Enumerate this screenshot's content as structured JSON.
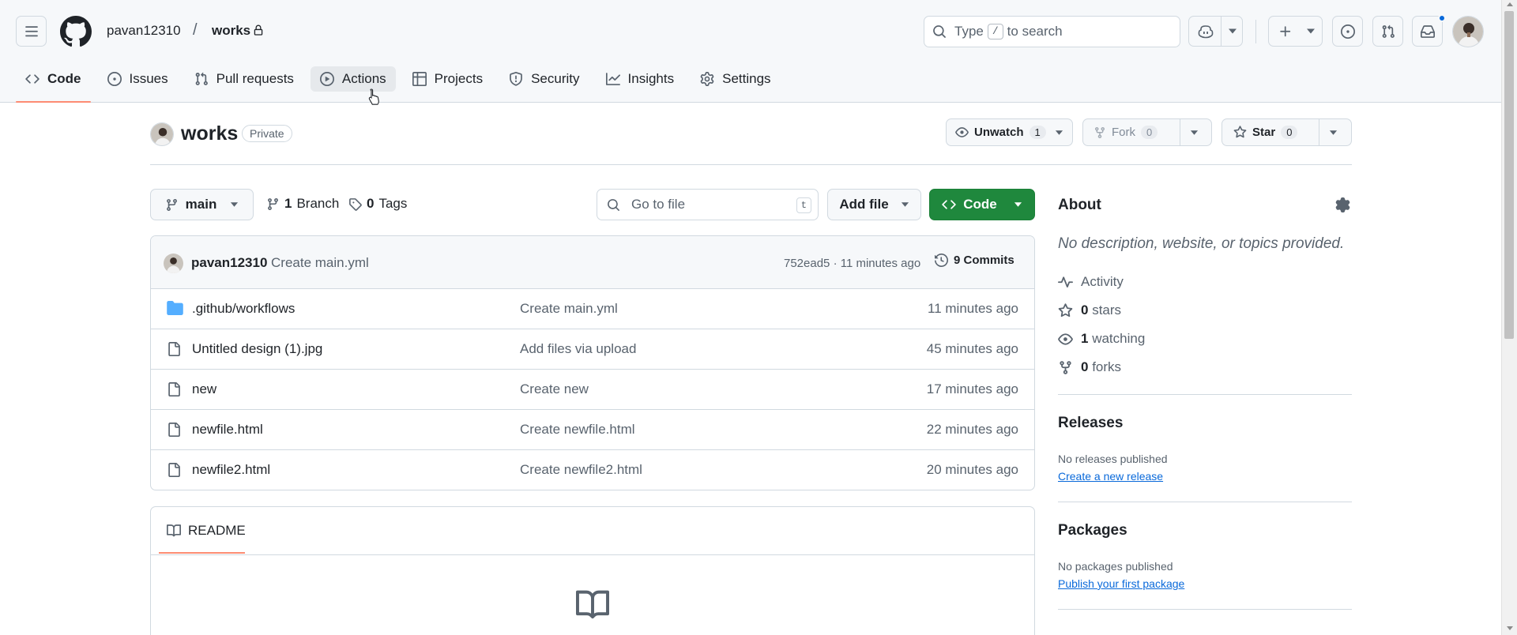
{
  "header": {
    "owner": "pavan12310",
    "separator": "/",
    "repo": "works",
    "search_prefix": "Type",
    "search_key": "/",
    "search_suffix": "to search"
  },
  "tabs": [
    {
      "label": "Code",
      "icon": "code-icon"
    },
    {
      "label": "Issues",
      "icon": "issue-icon"
    },
    {
      "label": "Pull requests",
      "icon": "pull-request-icon"
    },
    {
      "label": "Actions",
      "icon": "play-icon"
    },
    {
      "label": "Projects",
      "icon": "table-icon"
    },
    {
      "label": "Security",
      "icon": "shield-icon"
    },
    {
      "label": "Insights",
      "icon": "graph-icon"
    },
    {
      "label": "Settings",
      "icon": "gear-icon"
    }
  ],
  "repo": {
    "name": "works",
    "visibility": "Private",
    "unwatch_label": "Unwatch",
    "watch_count": "1",
    "fork_label": "Fork",
    "fork_count": "0",
    "star_label": "Star",
    "star_count": "0"
  },
  "toolbar": {
    "branch": "main",
    "branch_count": "1",
    "branch_label": "Branch",
    "tag_count": "0",
    "tag_label": "Tags",
    "goto_placeholder": "Go to file",
    "goto_key": "t",
    "add_file": "Add file",
    "code": "Code"
  },
  "commit": {
    "author": "pavan12310",
    "message": "Create main.yml",
    "meta": "752ead5 · 11 minutes ago",
    "count": "9 Commits"
  },
  "files": [
    {
      "name": ".github/workflows",
      "type": "folder",
      "message": "Create main.yml",
      "time": "11 minutes ago"
    },
    {
      "name": "Untitled design (1).jpg",
      "type": "file",
      "message": "Add files via upload",
      "time": "45 minutes ago"
    },
    {
      "name": "new",
      "type": "file",
      "message": "Create new",
      "time": "17 minutes ago"
    },
    {
      "name": "newfile.html",
      "type": "file",
      "message": "Create newfile.html",
      "time": "22 minutes ago"
    },
    {
      "name": "newfile2.html",
      "type": "file",
      "message": "Create newfile2.html",
      "time": "20 minutes ago"
    }
  ],
  "readme": {
    "label": "README"
  },
  "about": {
    "title": "About",
    "description": "No description, website, or topics provided.",
    "activity": "Activity",
    "stars_count": "0",
    "stars_label": "stars",
    "watching_count": "1",
    "watching_label": "watching",
    "forks_count": "0",
    "forks_label": "forks"
  },
  "releases": {
    "title": "Releases",
    "status": "No releases published",
    "link": "Create a new release"
  },
  "packages": {
    "title": "Packages",
    "status": "No packages published",
    "link": "Publish your first package"
  },
  "colors": {
    "accent_green": "#1f883d",
    "link_blue": "#0969da",
    "tab_underline": "#fd8c73",
    "folder_blue": "#54aeff"
  }
}
